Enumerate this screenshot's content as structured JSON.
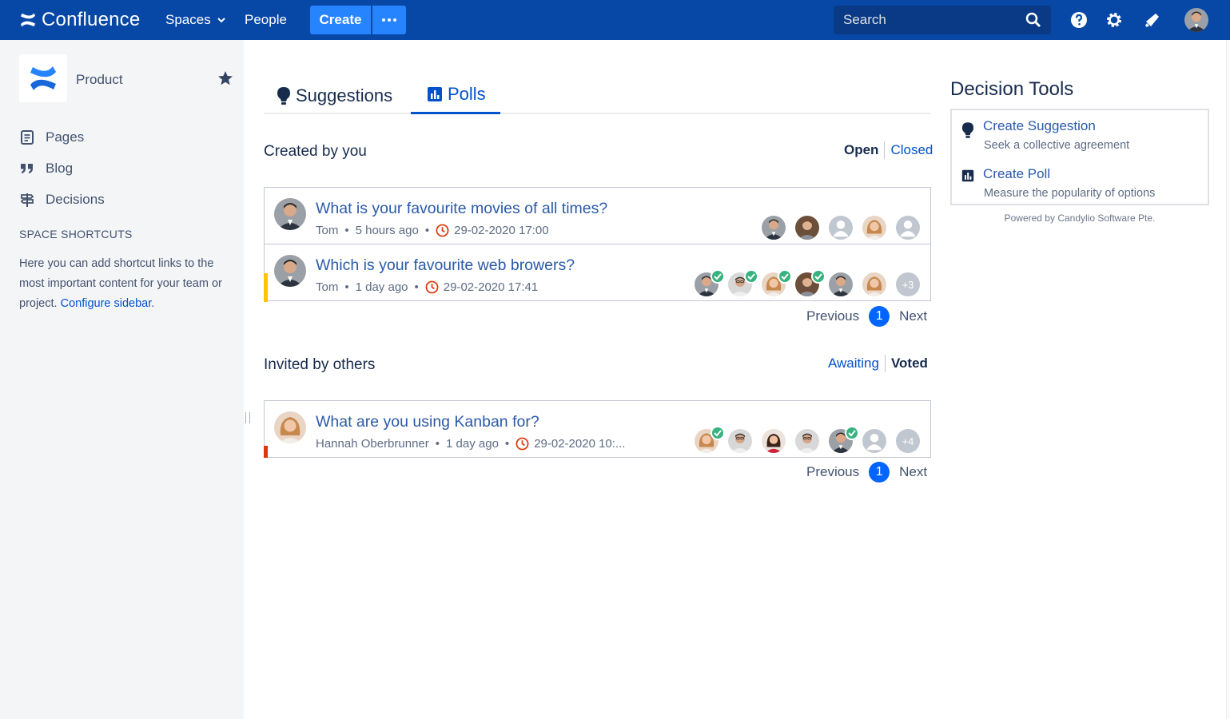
{
  "topnav": {
    "logo_text": "Confluence",
    "spaces_label": "Spaces",
    "people_label": "People",
    "create_label": "Create",
    "search_placeholder": "Search",
    "colors": {
      "bar": "#0747a6",
      "create": "#2684ff"
    }
  },
  "sidebar": {
    "space_name": "Product",
    "items": [
      {
        "label": "Pages",
        "icon": "pages-icon"
      },
      {
        "label": "Blog",
        "icon": "quote-icon"
      },
      {
        "label": "Decisions",
        "icon": "signpost-icon"
      }
    ],
    "shortcuts_title": "SPACE SHORTCUTS",
    "shortcuts_text": "Here you can add shortcut links to the most important content for your team or project.",
    "configure_link": "Configure sidebar",
    "configure_suffix": "."
  },
  "tabs": [
    {
      "label": "Suggestions",
      "icon": "lightbulb-icon",
      "active": false
    },
    {
      "label": "Polls",
      "icon": "bar-chart-icon",
      "active": true
    }
  ],
  "created": {
    "title": "Created by you",
    "filter_active": "Open",
    "filter_other": "Closed",
    "polls": [
      {
        "title": "What is your favourite movies of all times?",
        "author": "Tom",
        "ago": "5 hours ago",
        "deadline": "29-02-2020 17:00"
      },
      {
        "title": "Which is your favourite web browers?",
        "author": "Tom",
        "ago": "1 day ago",
        "deadline": "29-02-2020 17:41",
        "extra": "+3",
        "stripe": "#ffc400"
      }
    ]
  },
  "invited": {
    "title": "Invited by others",
    "filter_other": "Awaiting",
    "filter_active": "Voted",
    "polls": [
      {
        "title": "What are you using Kanban for?",
        "author": "Hannah Oberbrunner",
        "ago": "1 day ago",
        "deadline": "29-02-2020 10:...",
        "extra": "+4",
        "stripe": "#de350b"
      }
    ]
  },
  "pager": {
    "previous": "Previous",
    "page": "1",
    "next": "Next"
  },
  "decision_tools": {
    "title": "Decision Tools",
    "suggestion_title": "Create Suggestion",
    "suggestion_sub": "Seek a collective agreement",
    "poll_title": "Create Poll",
    "poll_sub": "Measure the popularity of options",
    "powered": "Powered by Candylio Software Pte."
  }
}
